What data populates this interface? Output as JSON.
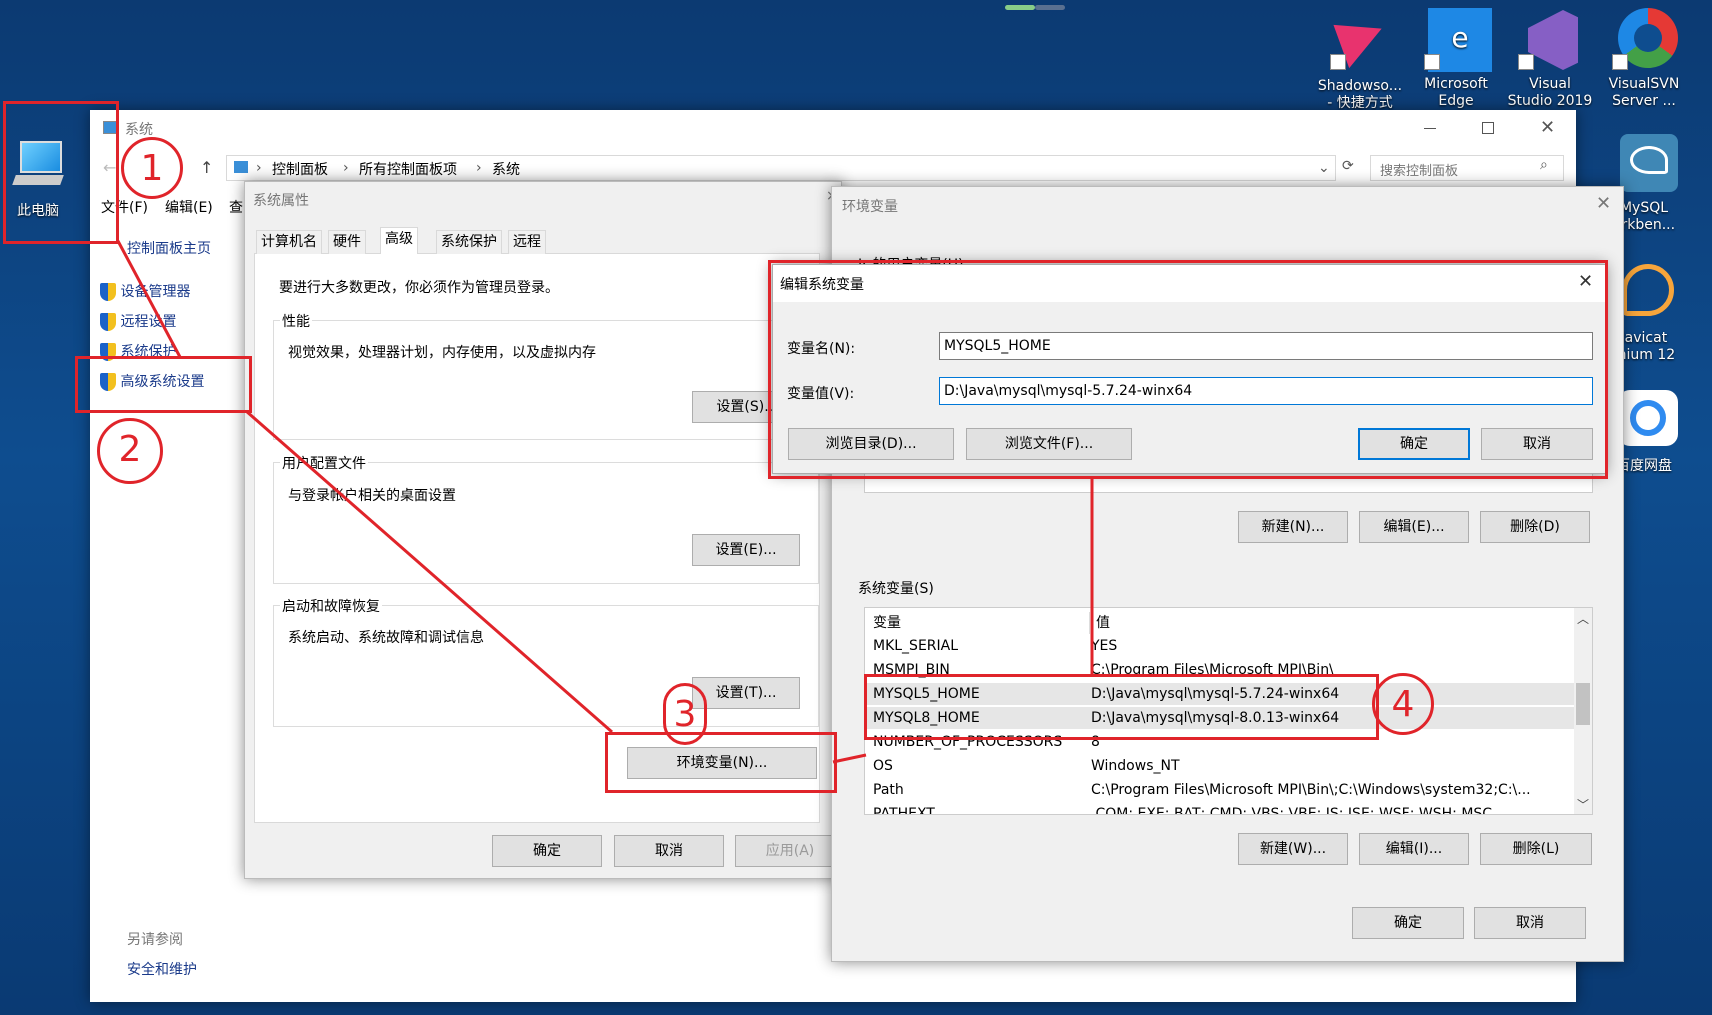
{
  "desktop": {
    "this_pc": "此电脑",
    "shadowsocks": [
      "Shadowso...",
      "- 快捷方式"
    ],
    "edge": [
      "Microsoft",
      "Edge"
    ],
    "vs": [
      "Visual",
      "Studio 2019"
    ],
    "svn": [
      "VisualSVN",
      "Server ..."
    ],
    "mysqlwb": [
      "MySQL",
      "orkben..."
    ],
    "navicat": [
      "lavicat",
      "mium 12"
    ],
    "baidu": "百度网盘"
  },
  "system_window": {
    "title": "系统",
    "breadcrumb": [
      "控制面板",
      "所有控制面板项",
      "系统"
    ],
    "search_placeholder": "搜索控制面板",
    "menu": [
      "文件(F)",
      "编辑(E)",
      "查"
    ],
    "home_link": "控制面板主页",
    "links": [
      "设备管理器",
      "远程设置",
      "系统保护",
      "高级系统设置"
    ],
    "see_also": "另请参阅",
    "security": "安全和维护"
  },
  "sysprops": {
    "title": "系统属性",
    "tabs": [
      "计算机名",
      "硬件",
      "高级",
      "系统保护",
      "远程"
    ],
    "admin_note": "要进行大多数更改，你必须作为管理员登录。",
    "perf_title": "性能",
    "perf_desc": "视觉效果，处理器计划，内存使用，以及虚拟内存",
    "perf_btn": "设置(S)...",
    "profile_title": "用户配置文件",
    "profile_desc": "与登录帐户相关的桌面设置",
    "profile_btn": "设置(E)...",
    "startup_title": "启动和故障恢复",
    "startup_desc": "系统启动、系统故障和调试信息",
    "startup_btn": "设置(T)...",
    "env_btn": "环境变量(N)...",
    "ok": "确定",
    "cancel": "取消",
    "apply": "应用(A)"
  },
  "envvars": {
    "title": "环境变量",
    "user_vars_label": "Jr 的用户变量(U)",
    "new_user": "新建(N)...",
    "edit_user": "编辑(E)...",
    "delete_user": "删除(D)",
    "sys_vars_label": "系统变量(S)",
    "col_var": "变量",
    "col_val": "值",
    "rows": [
      {
        "name": "MKL_SERIAL",
        "value": "YES"
      },
      {
        "name": "MSMPI_BIN",
        "value": "C:\\Program Files\\Microsoft MPI\\Bin\\"
      },
      {
        "name": "MYSQL5_HOME",
        "value": "D:\\Java\\mysql\\mysql-5.7.24-winx64"
      },
      {
        "name": "MYSQL8_HOME",
        "value": "D:\\Java\\mysql\\mysql-8.0.13-winx64"
      },
      {
        "name": "NUMBER_OF_PROCESSORS",
        "value": "8"
      },
      {
        "name": "OS",
        "value": "Windows_NT"
      },
      {
        "name": "Path",
        "value": "C:\\Program Files\\Microsoft MPI\\Bin\\;C:\\Windows\\system32;C:\\..."
      },
      {
        "name": "PATHEXT",
        "value": ".COM;.EXE;.BAT;.CMD;.VBS;.VBE;.JS;.JSE;.WSF;.WSH;.MSC"
      }
    ],
    "new_sys": "新建(W)...",
    "edit_sys": "编辑(I)...",
    "delete_sys": "删除(L)",
    "ok": "确定",
    "cancel": "取消"
  },
  "editvar": {
    "title": "编辑系统变量",
    "name_label": "变量名(N):",
    "name_value": "MYSQL5_HOME",
    "value_label": "变量值(V):",
    "value_value": "D:\\Java\\mysql\\mysql-5.7.24-winx64",
    "browse_dir": "浏览目录(D)...",
    "browse_file": "浏览文件(F)...",
    "ok": "确定",
    "cancel": "取消"
  },
  "annotations": [
    "1",
    "2",
    "3",
    "4"
  ]
}
